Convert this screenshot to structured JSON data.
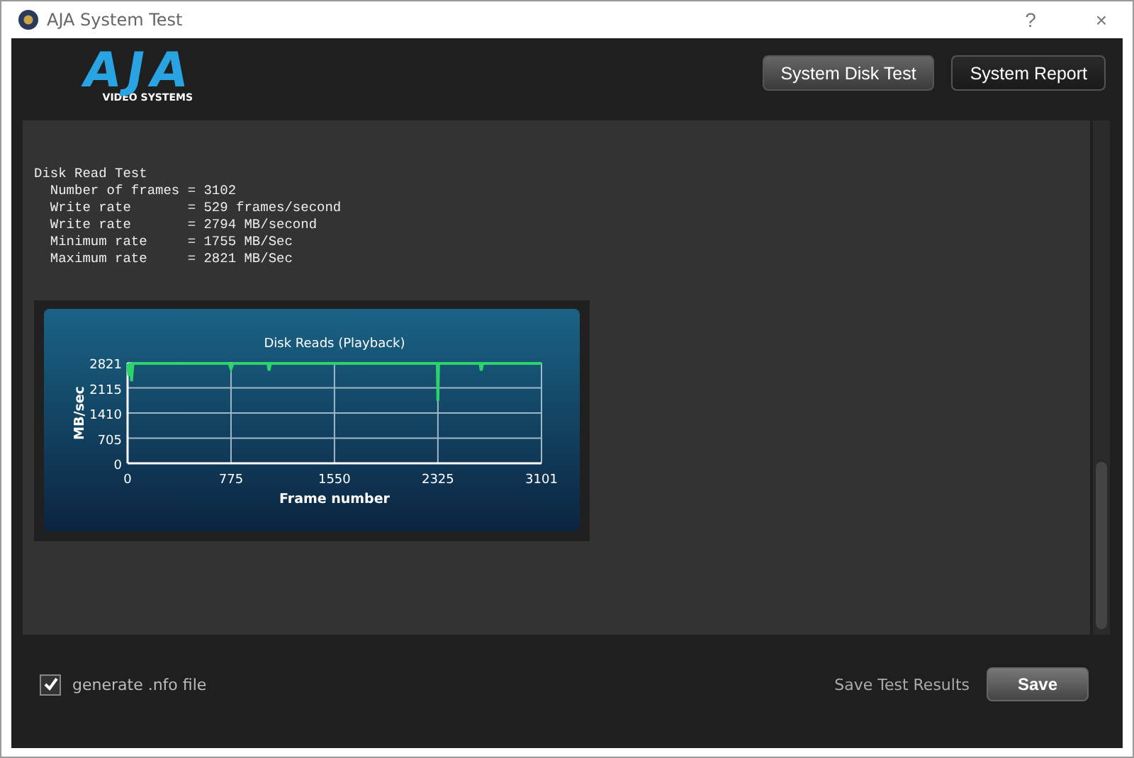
{
  "window": {
    "title": "AJA System Test",
    "help": "?",
    "close": "×"
  },
  "logo": {
    "mark": "AJA",
    "tagline": "VIDEO SYSTEMS"
  },
  "header_buttons": [
    {
      "label": "System Disk Test",
      "selected": true
    },
    {
      "label": "System Report",
      "selected": false
    }
  ],
  "results": {
    "heading": "Disk Read Test",
    "lines": [
      "  Number of frames = 3102",
      "  Write rate       = 529 frames/second",
      "  Write rate       = 2794 MB/second",
      "  Minimum rate     = 1755 MB/Sec",
      "  Maximum rate     = 2821 MB/Sec"
    ]
  },
  "chart_data": {
    "type": "line",
    "title": "Disk Reads (Playback)",
    "xlabel": "Frame number",
    "ylabel": "MB/sec",
    "x": [
      0,
      10,
      20,
      30,
      40,
      300,
      760,
      775,
      790,
      1050,
      1060,
      1070,
      1500,
      2000,
      2320,
      2325,
      2330,
      2640,
      2650,
      2660,
      3101
    ],
    "values": [
      2800,
      2450,
      2800,
      2300,
      2800,
      2800,
      2800,
      2650,
      2800,
      2800,
      2600,
      2800,
      2800,
      2800,
      2800,
      1750,
      2800,
      2800,
      2600,
      2800,
      2800
    ],
    "grid": true,
    "xlim": [
      0,
      3101
    ],
    "ylim": [
      0,
      2821
    ],
    "xticks": [
      0,
      775,
      1550,
      2325,
      3101
    ],
    "yticks": [
      0,
      705,
      1410,
      2115,
      2821
    ]
  },
  "footer": {
    "checkbox": {
      "label": "generate .nfo file",
      "checked": true
    },
    "save_label": "Save Test Results",
    "save_button": "Save"
  }
}
